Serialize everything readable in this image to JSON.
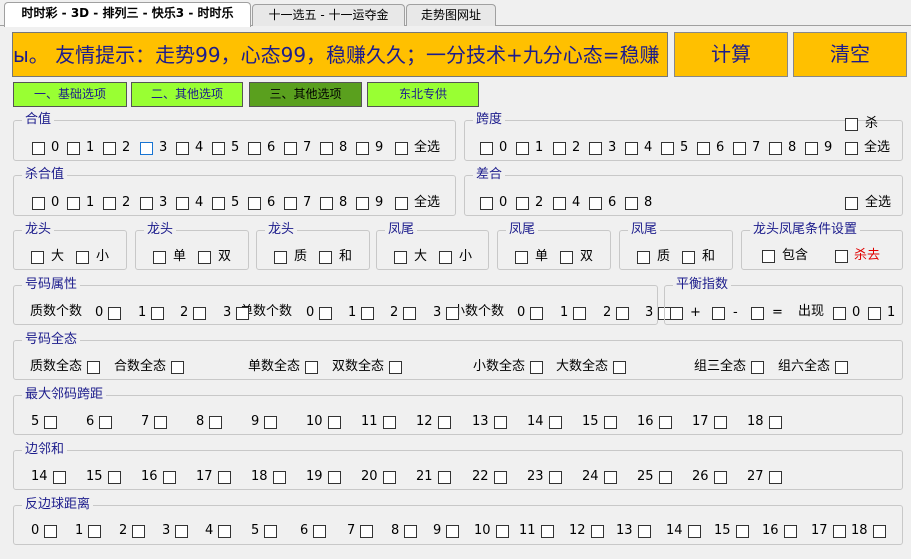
{
  "tabs": [
    "时时彩 - 3D - 排列三 - 快乐3 - 时时乐",
    "十一选五 - 十一运夺金",
    "走势图网址"
  ],
  "marquee": "ы。 友情提示：走势99，心态99，稳赚久久；一分技术+九分心态=稳赚",
  "buttons": {
    "calc": "计算",
    "clear": "清空"
  },
  "option_tabs": [
    "一、基础选项",
    "二、其他选项",
    "三、其他选项",
    "东北专供"
  ],
  "hezhi": {
    "title": "合值",
    "items": [
      "0",
      "1",
      "2",
      "3",
      "4",
      "5",
      "6",
      "7",
      "8",
      "9",
      "全选"
    ]
  },
  "kuadu": {
    "title": "跨度",
    "sha": "杀",
    "items": [
      "0",
      "1",
      "2",
      "3",
      "4",
      "5",
      "6",
      "7",
      "8",
      "9",
      "全选"
    ]
  },
  "shahezhi": {
    "title": "杀合值",
    "items": [
      "0",
      "1",
      "2",
      "3",
      "4",
      "5",
      "6",
      "7",
      "8",
      "9",
      "全选"
    ]
  },
  "chahe": {
    "title": "差合",
    "items": [
      "0",
      "2",
      "4",
      "6",
      "8"
    ],
    "all": "全选"
  },
  "dragon_groups": [
    {
      "title": "龙头",
      "items": [
        "大",
        "小"
      ]
    },
    {
      "title": "龙头",
      "items": [
        "单",
        "双"
      ]
    },
    {
      "title": "龙头",
      "items": [
        "质",
        "和"
      ]
    },
    {
      "title": "凤尾",
      "items": [
        "大",
        "小"
      ]
    },
    {
      "title": "凤尾",
      "items": [
        "单",
        "双"
      ]
    },
    {
      "title": "凤尾",
      "items": [
        "质",
        "和"
      ]
    }
  ],
  "condition": {
    "title": "龙头凤尾条件设置",
    "include": "包含",
    "kill": "杀去"
  },
  "attr": {
    "title": "号码属性",
    "prime_label": "质数个数",
    "odd_label": "单数个数",
    "small_label": "小数个数",
    "nums": [
      "0",
      "1",
      "2",
      "3"
    ]
  },
  "balance": {
    "title": "平衡指数",
    "plus": "+",
    "minus": "-",
    "eq": "=",
    "appear": "出现",
    "nums": [
      "0",
      "1"
    ]
  },
  "full": {
    "title": "号码全态",
    "items": [
      "质数全态",
      "合数全态",
      "单数全态",
      "双数全态",
      "小数全态",
      "大数全态",
      "组三全态",
      "组六全态"
    ]
  },
  "maxspan": {
    "title": "最大邻码跨距",
    "items": [
      "5",
      "6",
      "7",
      "8",
      "9",
      "10",
      "11",
      "12",
      "13",
      "14",
      "15",
      "16",
      "17",
      "18"
    ]
  },
  "edgesum": {
    "title": "边邻和",
    "items": [
      "14",
      "15",
      "16",
      "17",
      "18",
      "19",
      "20",
      "21",
      "22",
      "23",
      "24",
      "25",
      "26",
      "27"
    ]
  },
  "antiedge": {
    "title": "反边球距离",
    "items": [
      "0",
      "1",
      "2",
      "3",
      "4",
      "5",
      "6",
      "7",
      "8",
      "9",
      "10",
      "11",
      "12",
      "13",
      "14",
      "15",
      "16",
      "17",
      "18"
    ]
  },
  "colors": {
    "accent": "#ffc000",
    "green": "#99ff33",
    "green_selected": "#5aa01e",
    "title_text": "#1c1c8c",
    "kill_text": "#e00000"
  }
}
